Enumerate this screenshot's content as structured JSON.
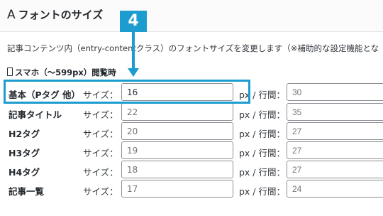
{
  "section": {
    "title_prefix": "A",
    "title": "フォントのサイズ"
  },
  "description": "記事コンテンツ内（entry-contentクラス）のフォントサイズを変更します（※補助的な設定機能とな",
  "device_heading": "スマホ（～599px）閲覧時",
  "labels": {
    "size": "サイズ：",
    "unit_line_height": "px / 行間："
  },
  "rows": [
    {
      "label": "基本（Pタグ 他）",
      "size_value": "16",
      "line_height_placeholder": "30"
    },
    {
      "label": "記事タイトル",
      "size_placeholder": "22",
      "line_height_placeholder": "35"
    },
    {
      "label": "H2タグ",
      "size_placeholder": "20",
      "line_height_placeholder": "27"
    },
    {
      "label": "H3タグ",
      "size_placeholder": "19",
      "line_height_placeholder": "27"
    },
    {
      "label": "H4タグ",
      "size_placeholder": "18",
      "line_height_placeholder": "27"
    },
    {
      "label": "記事一覧",
      "size_placeholder": "17",
      "line_height_placeholder": "24"
    }
  ],
  "annotation": {
    "step_number": "4",
    "accent_color": "#1c9ccf"
  }
}
